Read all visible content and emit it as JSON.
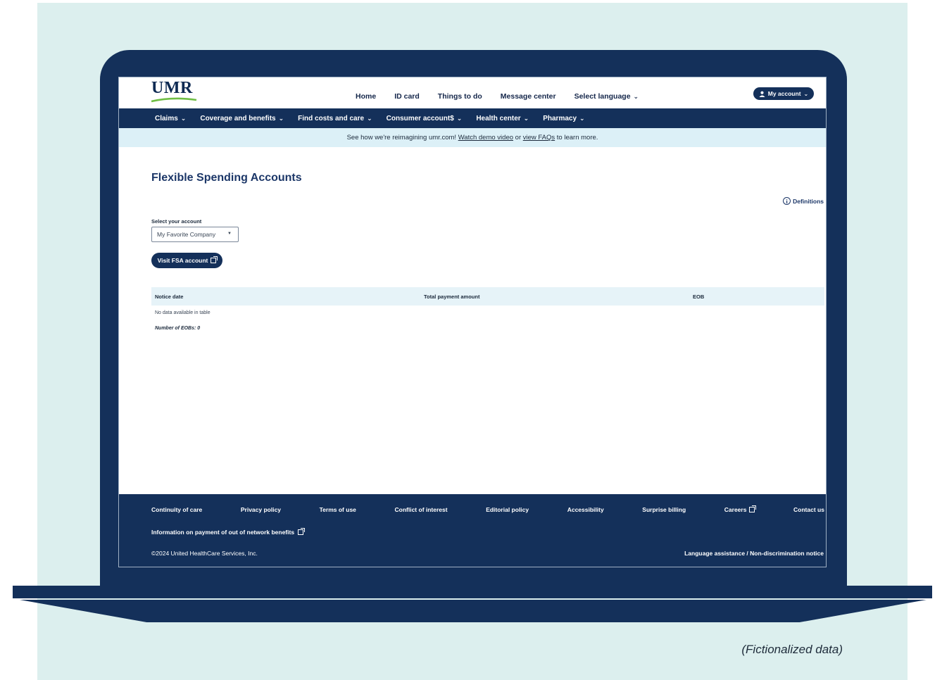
{
  "header": {
    "logo_text": "UMR",
    "top_nav": [
      "Home",
      "ID card",
      "Things to do",
      "Message center",
      "Select language"
    ],
    "account_label": "My account"
  },
  "main_nav": [
    "Claims",
    "Coverage and benefits",
    "Find costs and care",
    "Consumer account$",
    "Health center",
    "Pharmacy"
  ],
  "banner": {
    "text_before": "See how we're reimagining umr.com! ",
    "link1": "Watch demo video",
    "text_mid": " or ",
    "link2": "view FAQs",
    "text_after": " to learn more."
  },
  "page": {
    "title": "Flexible Spending Accounts",
    "definitions_label": "Definitions",
    "select_label": "Select your account",
    "selected_account": "My Favorite Company",
    "fsa_button_label": "Visit FSA account"
  },
  "table": {
    "columns": [
      "Notice date",
      "Total payment amount",
      "EOB"
    ],
    "empty_message": "No data available in table",
    "count_label": "Number of EOBs: 0"
  },
  "footer": {
    "links": [
      "Continuity of care",
      "Privacy policy",
      "Terms of use",
      "Conflict of interest",
      "Editorial policy",
      "Accessibility",
      "Surprise billing",
      "Careers",
      "Contact us"
    ],
    "out_of_network_label": "Information on payment of out of network benefits",
    "copyright": "©2024 United HealthCare Services, Inc.",
    "language_notice": "Language assistance / Non-discrimination notice"
  },
  "caption": "(Fictionalized data)",
  "colors": {
    "navy": "#14305a",
    "backdrop": "#dcefee",
    "banner": "#dcf0f7",
    "logo_swoosh": "#6fbe44"
  }
}
